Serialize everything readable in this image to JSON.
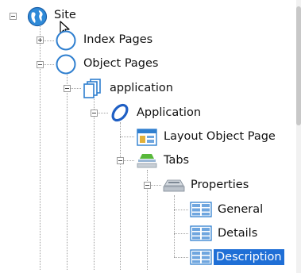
{
  "tree": {
    "nodes": [
      {
        "label": "Site",
        "icon": "globe-icon"
      },
      {
        "label": "Index Pages",
        "icon": "index-pages-icon"
      },
      {
        "label": "Object Pages",
        "icon": "object-pages-icon"
      },
      {
        "label": "application",
        "icon": "pages-stack-icon"
      },
      {
        "label": "Application",
        "icon": "ring-icon"
      },
      {
        "label": "Layout Object Page",
        "icon": "layout-page-icon"
      },
      {
        "label": "Tabs",
        "icon": "tabs-icon"
      },
      {
        "label": "Properties",
        "icon": "properties-tab-icon"
      },
      {
        "label": "General",
        "icon": "grid-icon"
      },
      {
        "label": "Details",
        "icon": "grid-icon"
      },
      {
        "label": "Description",
        "icon": "grid-icon"
      }
    ],
    "selected": "Description"
  }
}
